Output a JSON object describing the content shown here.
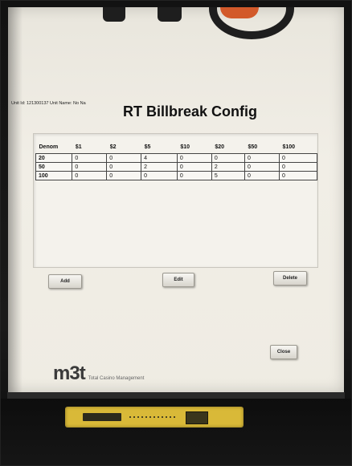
{
  "header": {
    "unit_id_label": "Unit Id: 121300137",
    "unit_name_label": "Unit Name: No Na",
    "title": "RT Billbreak Config"
  },
  "grid": {
    "columns": [
      "Denom",
      "$1",
      "$2",
      "$5",
      "$10",
      "$20",
      "$50",
      "$100"
    ],
    "rows": [
      [
        "20",
        "0",
        "0",
        "4",
        "0",
        "0",
        "0",
        "0"
      ],
      [
        "50",
        "0",
        "0",
        "2",
        "0",
        "2",
        "0",
        "0"
      ],
      [
        "100",
        "0",
        "0",
        "0",
        "0",
        "5",
        "0",
        "0"
      ]
    ]
  },
  "buttons": {
    "add": "Add",
    "edit": "Edit",
    "delete": "Delete",
    "close": "Close"
  },
  "footer": {
    "brand_logo": "m3t",
    "brand_tagline": "Total Casino Management"
  },
  "colors": {
    "screen_bg": "#efece3",
    "bill_acceptor": "#d9b938",
    "logo_accent": "#d2592a"
  }
}
